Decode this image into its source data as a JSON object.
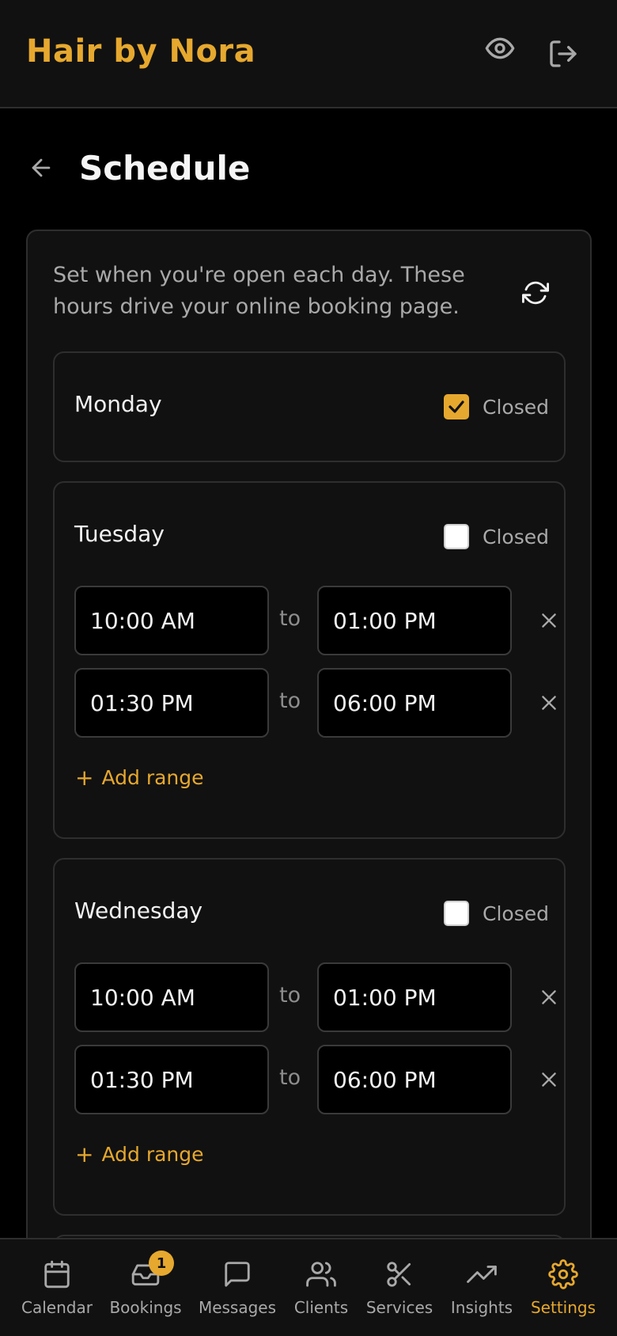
{
  "app": {
    "brand": "Hair by Nora",
    "accent_color": "#e6a82e",
    "icons": {
      "preview": "eye-icon",
      "logout": "logout-icon"
    }
  },
  "page": {
    "title": "Schedule",
    "back_icon": "arrow-left-icon",
    "intro": "Set when you're open each day. These hours drive your online booking page.",
    "refresh_icon": "refresh-icon"
  },
  "days": [
    {
      "name": "Monday",
      "closed": true,
      "closed_label": "Closed",
      "ranges": []
    },
    {
      "name": "Tuesday",
      "closed": false,
      "closed_label": "Closed",
      "ranges": [
        {
          "start": "10:00 AM",
          "to": "to",
          "end": "01:00 PM"
        },
        {
          "start": "01:30 PM",
          "to": "to",
          "end": "06:00 PM"
        }
      ],
      "add_label": "Add range",
      "add_symbol": "+"
    },
    {
      "name": "Wednesday",
      "closed": false,
      "closed_label": "Closed",
      "ranges": [
        {
          "start": "10:00 AM",
          "to": "to",
          "end": "01:00 PM"
        },
        {
          "start": "01:30 PM",
          "to": "to",
          "end": "06:00 PM"
        }
      ],
      "add_label": "Add range",
      "add_symbol": "+"
    }
  ],
  "nav": [
    {
      "label": "Calendar",
      "icon": "calendar-icon",
      "active": false
    },
    {
      "label": "Bookings",
      "icon": "inbox-icon",
      "active": false,
      "badge": "1"
    },
    {
      "label": "Messages",
      "icon": "message-icon",
      "active": false
    },
    {
      "label": "Clients",
      "icon": "users-icon",
      "active": false
    },
    {
      "label": "Services",
      "icon": "scissors-icon",
      "active": false
    },
    {
      "label": "Insights",
      "icon": "trending-up-icon",
      "active": false
    },
    {
      "label": "Settings",
      "icon": "gear-icon",
      "active": true
    }
  ]
}
